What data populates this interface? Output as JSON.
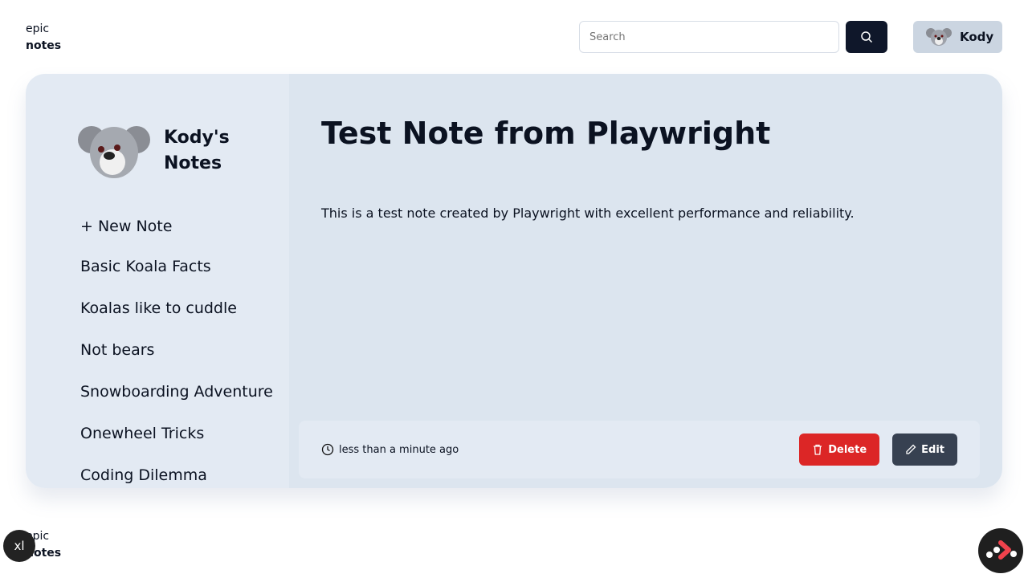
{
  "header": {
    "logo_top": "epic",
    "logo_bottom": "notes",
    "search_placeholder": "Search",
    "user_name": "Kody"
  },
  "sidebar": {
    "owner_title": "Kody's Notes",
    "new_note": "New Note",
    "notes": [
      "Basic Koala Facts",
      "Koalas like to cuddle",
      "Not bears",
      "Snowboarding Adventure",
      "Onewheel Tricks",
      "Coding Dilemma"
    ]
  },
  "note": {
    "title": "Test Note from Playwright",
    "content": "This is a test note created by Playwright with excellent performance and reliability.",
    "updated": "less than a minute ago",
    "delete_label": "Delete",
    "edit_label": "Edit"
  },
  "footer": {
    "logo_top": "epic",
    "logo_bottom": "notes",
    "dev_badge": "xl"
  }
}
